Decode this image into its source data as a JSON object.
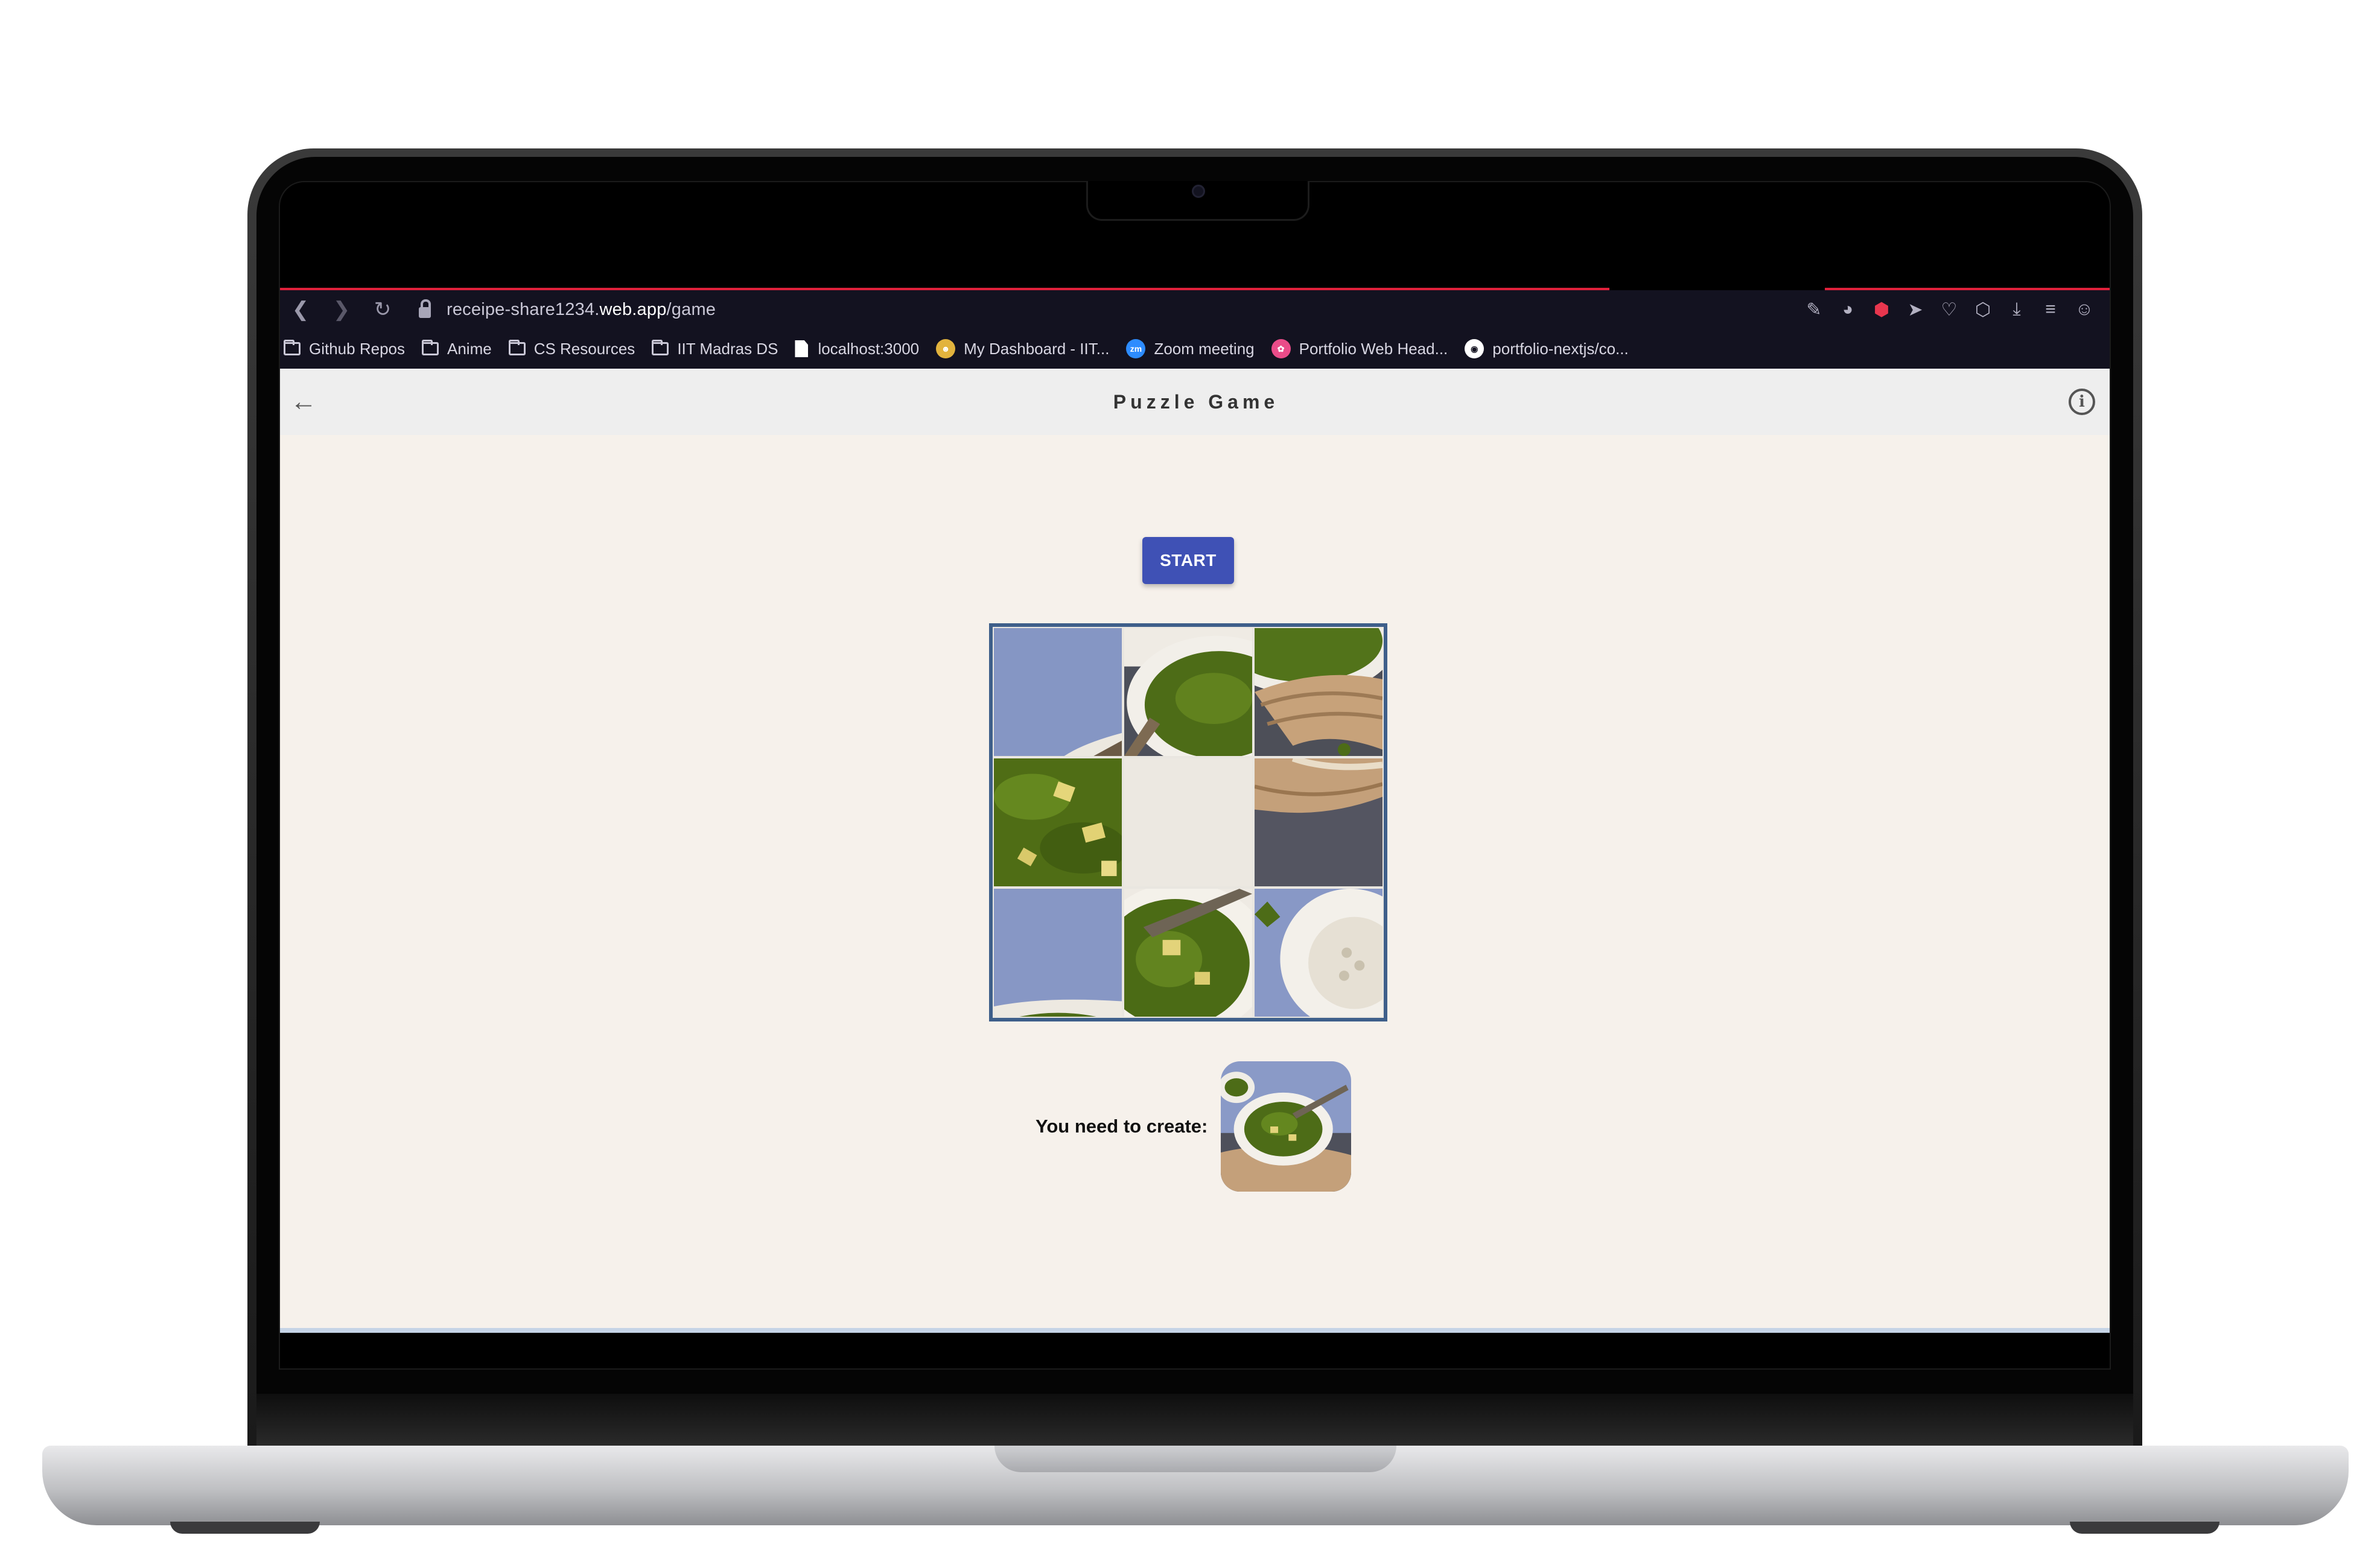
{
  "browser": {
    "url_prefix": "receipe-share1234.",
    "url_host": "web.app",
    "url_path": "/game",
    "bookmarks": [
      {
        "label": "Github Repos",
        "icon": "folder-icon"
      },
      {
        "label": "Anime",
        "icon": "folder-icon"
      },
      {
        "label": "CS Resources",
        "icon": "folder-icon"
      },
      {
        "label": "IIT Madras DS",
        "icon": "folder-icon"
      },
      {
        "label": "localhost:3000",
        "icon": "page-icon"
      },
      {
        "label": "My Dashboard - IIT...",
        "icon": "emoji-icon"
      },
      {
        "label": "Zoom meeting",
        "icon": "zoom-icon",
        "badge": "zm"
      },
      {
        "label": "Portfolio Web Head...",
        "icon": "dribbble-icon"
      },
      {
        "label": "portfolio-nextjs/co...",
        "icon": "github-icon"
      }
    ]
  },
  "app": {
    "title": "Puzzle Game",
    "start_label": "START",
    "target_label": "You need to create:"
  },
  "colors": {
    "start_button": "#3f51b5",
    "board_border": "#3e5f8a",
    "app_background": "#f6f1eb",
    "loading_bar": "#e0213b"
  }
}
